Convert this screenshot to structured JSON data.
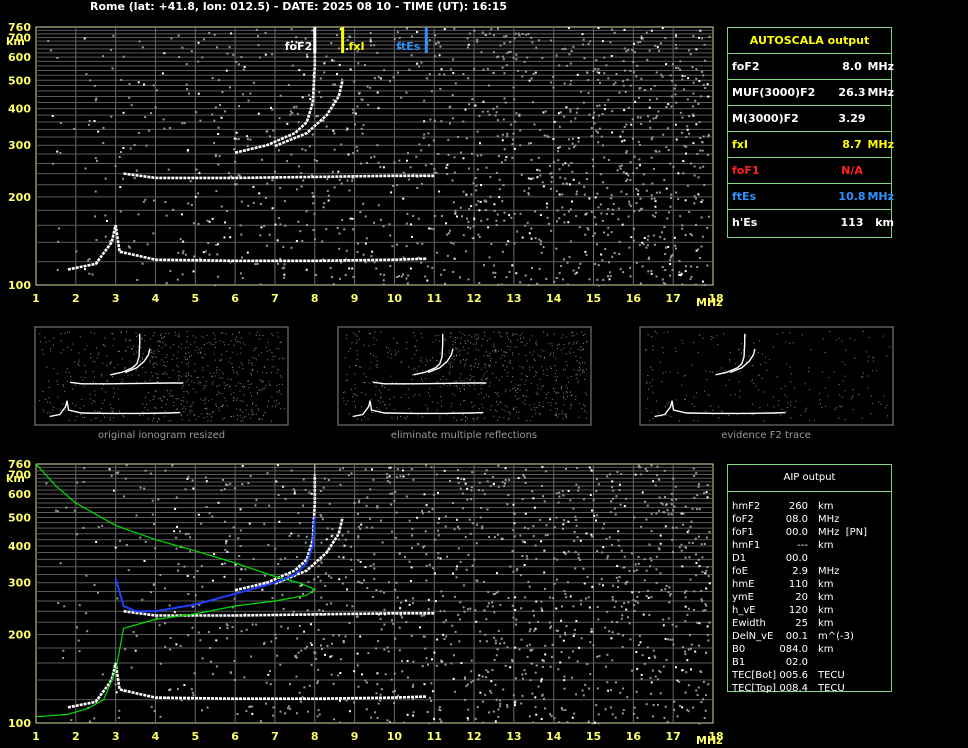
{
  "header": "Rome (lat: +41.8, lon: 012.5) - DATE: 2025 08 10 - TIME (UT): 16:15",
  "autoscala": {
    "title": "AUTOSCALA output",
    "rows": [
      {
        "key": "foF2",
        "value": "8.0",
        "unit": "MHz",
        "color": "#ffffff"
      },
      {
        "key": "MUF(3000)F2",
        "value": "26.3",
        "unit": "MHz",
        "color": "#ffffff"
      },
      {
        "key": "M(3000)F2",
        "value": "3.29",
        "unit": "",
        "color": "#ffffff"
      },
      {
        "key": "fxI",
        "value": "8.7",
        "unit": "MHz",
        "color": "#ffff00"
      },
      {
        "key": "foF1",
        "value": "N/A",
        "unit": "",
        "color": "#ff2020"
      },
      {
        "key": "ftEs",
        "value": "10.8",
        "unit": "MHz",
        "color": "#3090ff"
      },
      {
        "key": "h'Es",
        "value": "113",
        "unit": "km",
        "color": "#ffffff"
      }
    ]
  },
  "aip": {
    "title": "AIP output",
    "rows": [
      {
        "key": "hmF2",
        "value": "260",
        "unit": "km"
      },
      {
        "key": "foF2",
        "value": "08.0",
        "unit": "MHz"
      },
      {
        "key": "foF1",
        "value": "00.0",
        "unit": "MHz  [PN]"
      },
      {
        "key": "hmF1",
        "value": "---",
        "unit": "km"
      },
      {
        "key": "D1",
        "value": "00.0",
        "unit": ""
      },
      {
        "key": "foE",
        "value": "2.9",
        "unit": "MHz"
      },
      {
        "key": "hmE",
        "value": "110",
        "unit": "km"
      },
      {
        "key": "ymE",
        "value": "20",
        "unit": "km"
      },
      {
        "key": "h_vE",
        "value": "120",
        "unit": "km"
      },
      {
        "key": "Ewidth",
        "value": "25",
        "unit": "km"
      },
      {
        "key": "DelN_vE",
        "value": "00.1",
        "unit": "m^(-3)"
      },
      {
        "key": "B0",
        "value": "084.0",
        "unit": "km"
      },
      {
        "key": "B1",
        "value": "02.0",
        "unit": ""
      },
      {
        "key": "TEC[Bot]",
        "value": "005.6",
        "unit": "TECU"
      },
      {
        "key": "TEC[Top]",
        "value": "008.4",
        "unit": "TECU"
      }
    ]
  },
  "thumbnails": [
    {
      "caption": "original ionogram resized"
    },
    {
      "caption": "eliminate multiple reflections"
    },
    {
      "caption": "evidence F2 trace"
    }
  ],
  "markers": {
    "foF2": {
      "label": "foF2",
      "freq": 8.0,
      "color": "#ffffff"
    },
    "fxI": {
      "label": "fxI",
      "freq": 8.7,
      "color": "#ffff00"
    },
    "ftEs": {
      "label": "ftEs",
      "freq": 10.8,
      "color": "#3090ff"
    }
  },
  "chart_data": [
    {
      "type": "scatter",
      "xlim": [
        1,
        18
      ],
      "ylim": [
        100,
        760
      ],
      "xticks": [
        "1",
        "2",
        "3",
        "4",
        "5",
        "6",
        "7",
        "8",
        "9",
        "10",
        "11",
        "12",
        "13",
        "14",
        "15",
        "16",
        "17",
        "18"
      ],
      "yticks": [
        "100",
        "200",
        "300",
        "400",
        "500",
        "600",
        "700",
        "760"
      ],
      "xunit": "MHz",
      "yunit": "km",
      "grid": true,
      "series": [
        {
          "values": [
            [
              1.8,
              113
            ],
            [
              2.5,
              118
            ],
            [
              2.9,
              140
            ],
            [
              3.0,
              160
            ],
            [
              3.1,
              130
            ],
            [
              4,
              122
            ],
            [
              6,
              121
            ],
            [
              8,
              121
            ],
            [
              10,
              122
            ],
            [
              10.8,
              123
            ]
          ]
        },
        {
          "values": [
            [
              3.2,
              240
            ],
            [
              4,
              232
            ],
            [
              6,
              232
            ],
            [
              8,
              234
            ],
            [
              10,
              236
            ],
            [
              11,
              236
            ]
          ]
        },
        {
          "values": [
            [
              6,
              283
            ],
            [
              6.8,
              300
            ],
            [
              7.5,
              330
            ],
            [
              7.8,
              360
            ],
            [
              7.95,
              420
            ],
            [
              8.0,
              560
            ],
            [
              8.0,
              700
            ]
          ]
        },
        {
          "values": [
            [
              7,
              298
            ],
            [
              7.8,
              330
            ],
            [
              8.3,
              380
            ],
            [
              8.6,
              440
            ],
            [
              8.7,
              500
            ]
          ]
        }
      ]
    },
    {
      "type": "line",
      "xlim": [
        1,
        18
      ],
      "ylim": [
        100,
        760
      ],
      "xticks": [
        "1",
        "2",
        "3",
        "4",
        "5",
        "6",
        "7",
        "8",
        "9",
        "10",
        "11",
        "12",
        "13",
        "14",
        "15",
        "16",
        "17",
        "18"
      ],
      "yticks": [
        "100",
        "200",
        "300",
        "400",
        "500",
        "600",
        "700",
        "760"
      ],
      "xunit": "MHz",
      "yunit": "km",
      "grid": true,
      "series": [
        {
          "color": "#00dd00",
          "values": [
            [
              1,
              760
            ],
            [
              1.5,
              640
            ],
            [
              2,
              560
            ],
            [
              3,
              470
            ],
            [
              4,
              420
            ],
            [
              5,
              385
            ],
            [
              6,
              350
            ],
            [
              7,
              315
            ],
            [
              7.6,
              300
            ],
            [
              8,
              285
            ],
            [
              7.8,
              272
            ],
            [
              7,
              260
            ],
            [
              6,
              250
            ],
            [
              5,
              235
            ],
            [
              4,
              225
            ],
            [
              3.2,
              210
            ],
            [
              3,
              150
            ],
            [
              2.7,
              120
            ],
            [
              2.3,
              112
            ],
            [
              1.8,
              107
            ],
            [
              1,
              105
            ]
          ]
        },
        {
          "color": "#2040ff",
          "values": [
            [
              3,
              310
            ],
            [
              3.2,
              250
            ],
            [
              3.5,
              240
            ],
            [
              4,
              240
            ],
            [
              5,
              253
            ],
            [
              6,
              275
            ],
            [
              7,
              300
            ],
            [
              7.5,
              320
            ],
            [
              7.8,
              350
            ],
            [
              7.95,
              400
            ],
            [
              8.0,
              500
            ]
          ]
        }
      ]
    }
  ]
}
